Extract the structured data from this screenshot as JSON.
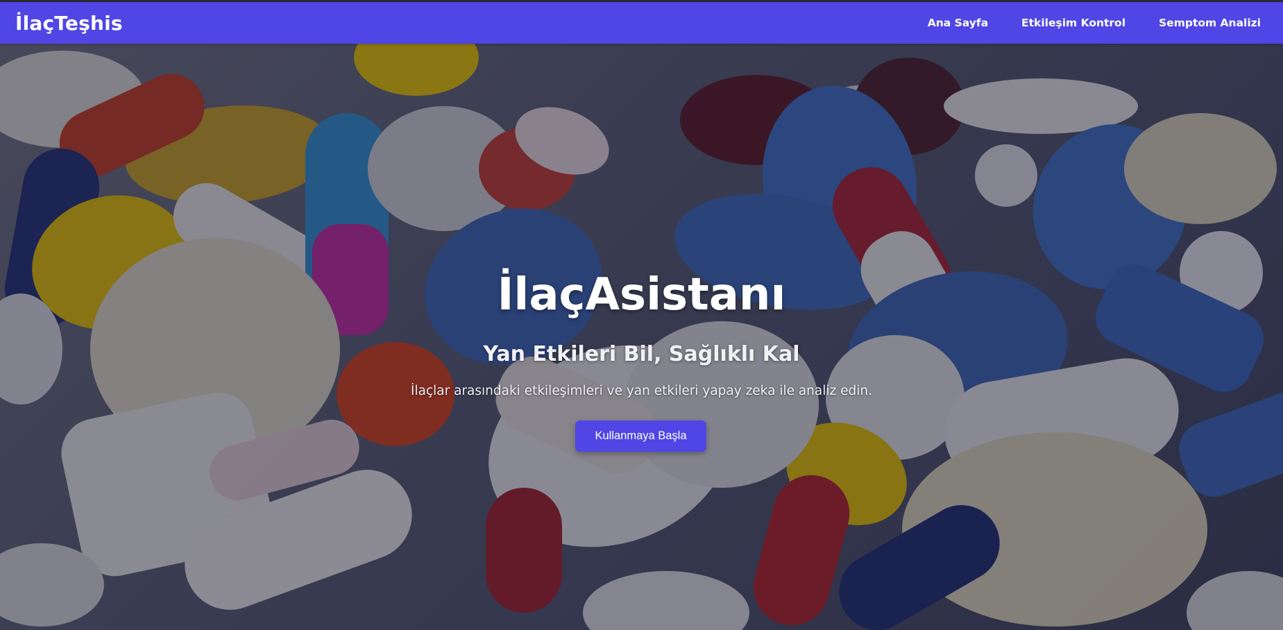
{
  "navbar": {
    "brand": "İlaçTeşhis",
    "links": [
      {
        "label": "Ana Sayfa"
      },
      {
        "label": "Etkileşim Kontrol"
      },
      {
        "label": "Semptom Analizi"
      }
    ]
  },
  "hero": {
    "title": "İlaçAsistanı",
    "subtitle": "Yan Etkileri Bil, Sağlıklı Kal",
    "description": "İlaçlar arasındaki etkileşimleri ve yan etkileri yapay zeka ile analiz edin.",
    "cta_label": "Kullanmaya Başla"
  },
  "colors": {
    "primary": "#4f46e5",
    "text_on_primary": "#ffffff"
  }
}
